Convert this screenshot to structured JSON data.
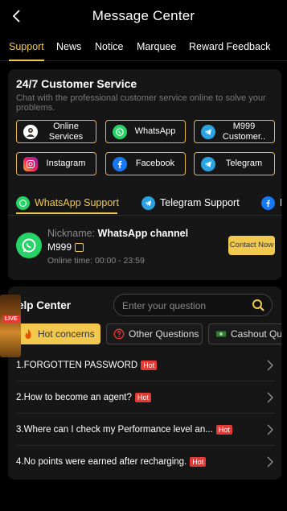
{
  "header": {
    "title": "Message Center"
  },
  "tabs": [
    {
      "label": "Support",
      "active": true
    },
    {
      "label": "News",
      "active": false
    },
    {
      "label": "Notice",
      "active": false
    },
    {
      "label": "Marquee",
      "active": false
    },
    {
      "label": "Reward Feedback",
      "active": false
    }
  ],
  "customer_service": {
    "title": "24/7 Customer Service",
    "description": "Chat with the professional customer service online to solve your problems.",
    "channels": [
      {
        "label": "Online Services",
        "icon": "online-service-icon"
      },
      {
        "label": "WhatsApp",
        "icon": "whatsapp-icon"
      },
      {
        "label": "M999 Customer..",
        "icon": "telegram-icon"
      },
      {
        "label": "Instagram",
        "icon": "instagram-icon"
      },
      {
        "label": "Facebook",
        "icon": "facebook-icon"
      },
      {
        "label": "Telegram",
        "icon": "telegram-icon"
      }
    ]
  },
  "support_tabs": [
    {
      "label": "WhatsApp Support",
      "icon": "whatsapp-icon",
      "active": true
    },
    {
      "label": "Telegram Support",
      "icon": "telegram-icon",
      "active": false
    },
    {
      "label": "F",
      "icon": "facebook-icon",
      "active": false
    }
  ],
  "agent": {
    "nickname_label": "Nickname: ",
    "nickname": "WhatsApp channel",
    "account": "M999",
    "online_time": "Online time: 00:00 - 23:59",
    "contact_label": "Contact Now"
  },
  "help": {
    "title": "elp Center",
    "search_placeholder": "Enter your question",
    "categories": [
      {
        "label": "Hot concerns",
        "icon": "fire-icon",
        "active": true
      },
      {
        "label": "Other Questions",
        "icon": "question-icon",
        "active": false
      },
      {
        "label": "Cashout Qu",
        "icon": "cash-icon",
        "active": false
      }
    ],
    "hot_label": "Hot",
    "faqs": [
      {
        "q": "1.FORGOTTEN PASSWORD",
        "hot": true
      },
      {
        "q": "2.How to become an agent?",
        "hot": true
      },
      {
        "q": "3.Where can I check my Performance level an...",
        "hot": true
      },
      {
        "q": "4.No points were earned after recharging.",
        "hot": true
      }
    ]
  },
  "live_badge": {
    "label": "LIVE"
  },
  "colors": {
    "accent": "#f2c94c",
    "card": "#161616",
    "hot": "#e53935",
    "whatsapp": "#25d366",
    "telegram": "#2aa3e0",
    "facebook": "#1877f2"
  }
}
